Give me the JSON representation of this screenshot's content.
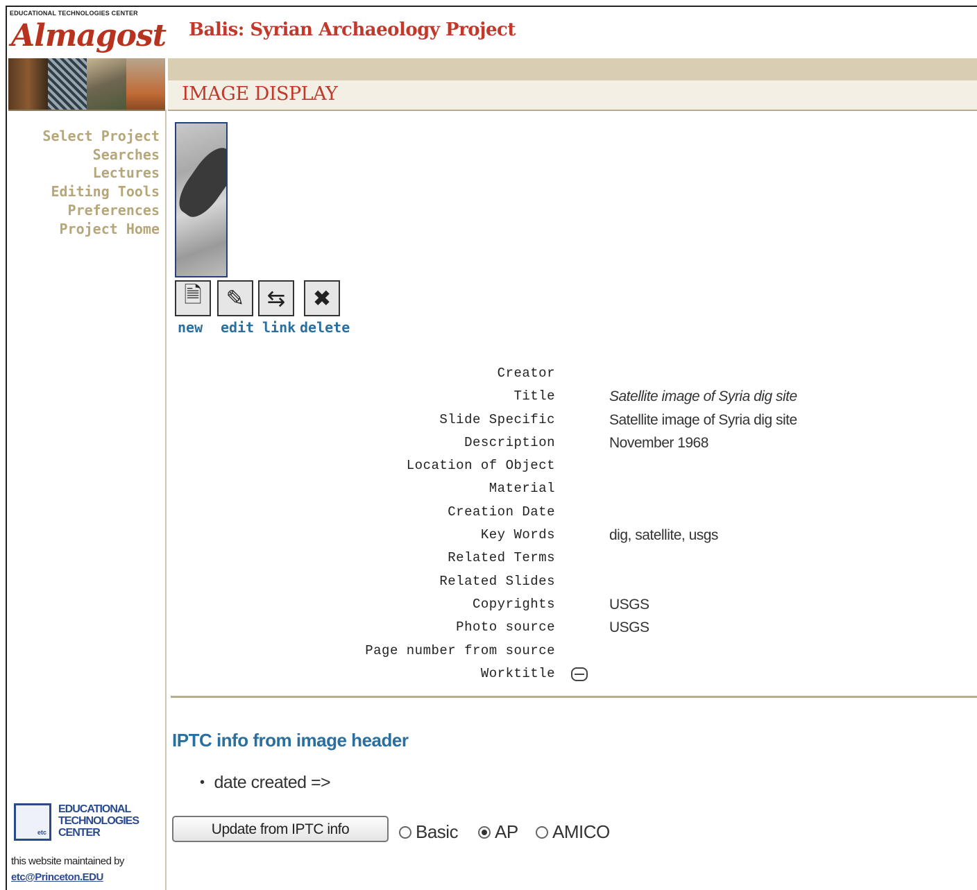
{
  "brand": {
    "org_small": "EDUCATIONAL TECHNOLOGIES CENTER",
    "logo_text": "Almagost"
  },
  "header": {
    "site_title": "Balis: Syrian Archaeology Project",
    "page_heading": "IMAGE DISPLAY"
  },
  "sidebar": {
    "items": [
      {
        "label": "Select Project"
      },
      {
        "label": "Searches"
      },
      {
        "label": "Lectures"
      },
      {
        "label": "Editing Tools"
      },
      {
        "label": "Preferences"
      },
      {
        "label": "Project Home"
      }
    ]
  },
  "toolbar": {
    "new_label": "new",
    "edit_label": "edit",
    "link_label": "link",
    "delete_label": "delete"
  },
  "metadata": {
    "rows": [
      {
        "key": "Creator",
        "value": ""
      },
      {
        "key": "Title",
        "value": "Satellite image of Syria dig site"
      },
      {
        "key": "Slide Specific",
        "value": "Satellite image of Syria dig site"
      },
      {
        "key": "Description",
        "value": "November 1968"
      },
      {
        "key": "Location of Object",
        "value": ""
      },
      {
        "key": "Material",
        "value": ""
      },
      {
        "key": "Creation Date",
        "value": ""
      },
      {
        "key": "Key Words",
        "value": "dig, satellite, usgs"
      },
      {
        "key": "Related Terms",
        "value": ""
      },
      {
        "key": "Related Slides",
        "value": ""
      },
      {
        "key": "Copyrights",
        "value": "USGS"
      },
      {
        "key": "Photo source",
        "value": "USGS"
      },
      {
        "key": "Page number from source",
        "value": ""
      },
      {
        "key": "Worktitle",
        "value": ""
      }
    ]
  },
  "iptc": {
    "heading": "IPTC info from image header",
    "items": [
      "date created =>"
    ],
    "update_button": "Update from IPTC info",
    "options": [
      {
        "label": "Basic",
        "checked": false
      },
      {
        "label": "AP",
        "checked": true
      },
      {
        "label": "AMICO",
        "checked": false
      }
    ]
  },
  "footer": {
    "etc_logo_text": "etc",
    "etc_name_1": "EDUCATIONAL",
    "etc_name_2": "TECHNOLOGIES",
    "etc_name_3": "CENTER",
    "maintained": "this website maintained by",
    "email": "etc@Princeton.EDU"
  },
  "colors": {
    "accent_red": "#c0392b",
    "link_blue": "#2a6f9e",
    "nav_tan": "#b5a77a",
    "band_tan": "#d9cdb4"
  }
}
